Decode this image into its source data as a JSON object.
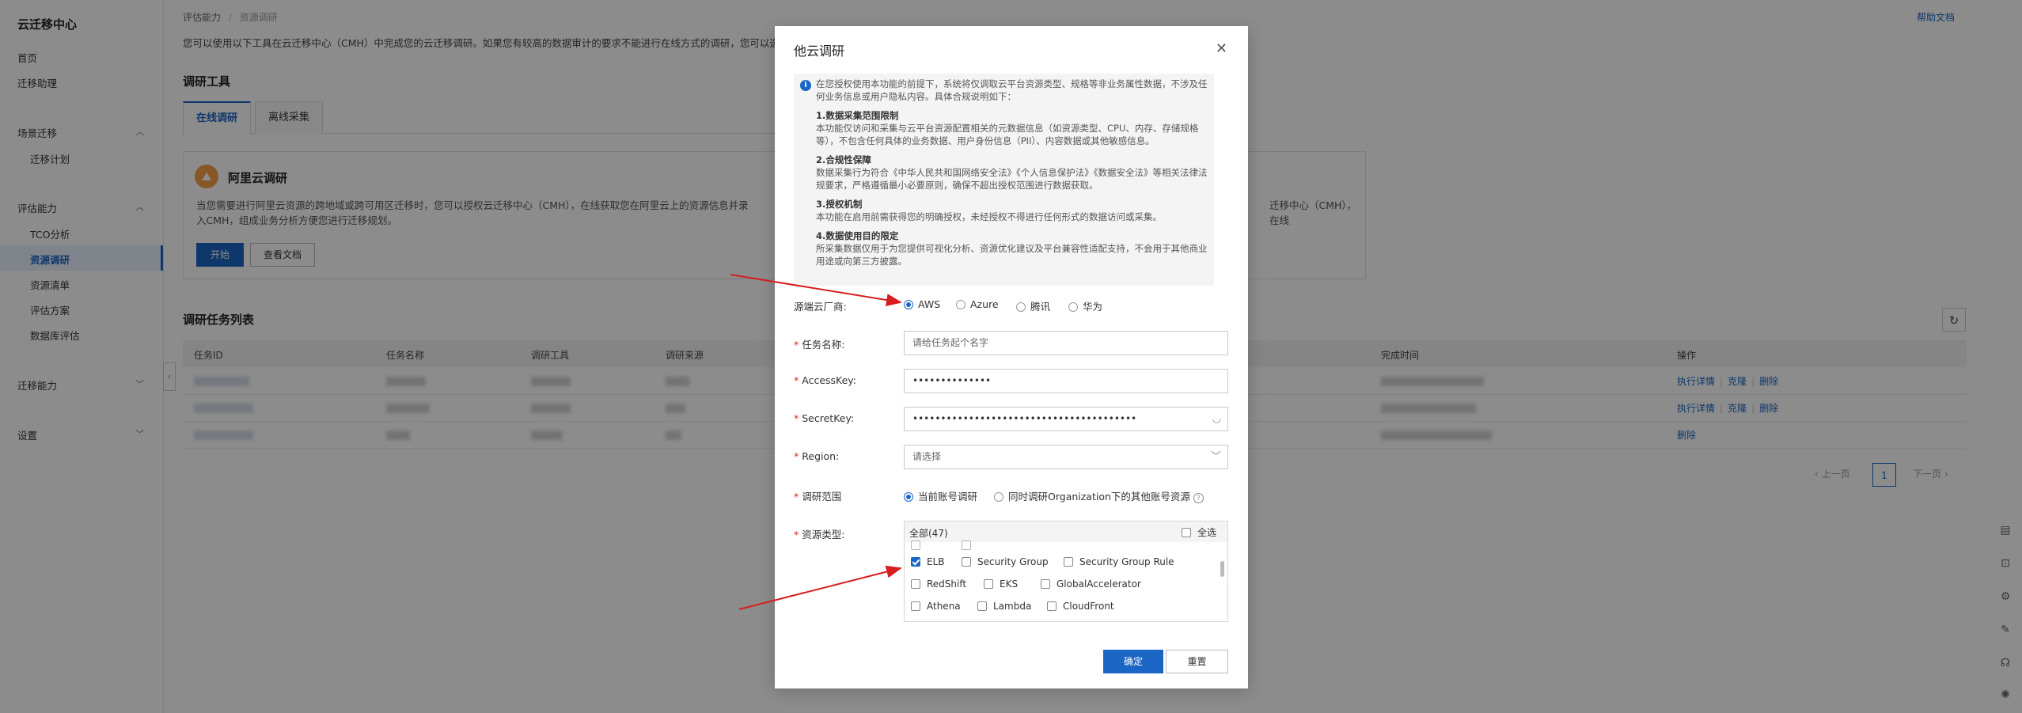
{
  "sidebar": {
    "title": "云迁移中心",
    "items": {
      "home": "首页",
      "assistant": "迁移助理",
      "scene": "场景迁移",
      "plan": "迁移计划",
      "assess": "评估能力",
      "tco": "TCO分析",
      "research": "资源调研",
      "inventory": "资源清单",
      "scheme": "评估方案",
      "db_assess": "数据库评估",
      "migrate": "迁移能力",
      "settings": "设置"
    }
  },
  "header": {
    "breadcrumb_1": "评估能力",
    "breadcrumb_sep": "/",
    "breadcrumb_2": "资源调研",
    "help": "帮助文档"
  },
  "main": {
    "description": "您可以使用以下工具在云迁移中心（CMH）中完成您的云迁移调研。如果您有较高的数据审计的要求不能进行在线方式的调研，您可以选择相",
    "tools_title": "调研工具",
    "tab_online": "在线调研",
    "tab_offline": "离线采集",
    "card_title": "阿里云调研",
    "card_text": "当您需要进行阿里云资源的跨地域或跨可用区迁移时，您可以授权云迁移中心（CMH），在线获取您在阿里云上的资源信息并录入CMH，组成业务分析方便您进行迁移规划。",
    "card_text_right": "迁移中心（CMH），在线",
    "btn_start": "开始",
    "btn_docs": "查看文档",
    "task_list_title": "调研任务列表",
    "columns": [
      "任务ID",
      "任务名称",
      "调研工具",
      "调研来源",
      "完成时间",
      "操作"
    ],
    "row_ops": [
      [
        "执行详情",
        "克隆",
        "删除"
      ],
      [
        "执行详情",
        "克隆",
        "删除"
      ],
      [
        "删除"
      ]
    ],
    "pager_prev": "上一页",
    "pager_page": "1",
    "pager_next": "下一页"
  },
  "modal": {
    "title": "他云调研",
    "notice_intro": "在您授权使用本功能的前提下，系统将仅调取云平台资源类型、规格等非业务属性数据，不涉及任何业务信息或用户隐私内容。具体合规说明如下：",
    "sections": [
      {
        "h": "1.数据采集范围限制",
        "t": "本功能仅访问和采集与云平台资源配置相关的元数据信息（如资源类型、CPU、内存、存储规格等），不包含任何具体的业务数据、用户身份信息（PII）、内容数据或其他敏感信息。"
      },
      {
        "h": "2.合规性保障",
        "t": "数据采集行为符合《中华人民共和国网络安全法》《个人信息保护法》《数据安全法》等相关法律法规要求，严格遵循最小必要原则，确保不超出授权范围进行数据获取。"
      },
      {
        "h": "3.授权机制",
        "t": "本功能在启用前需获得您的明确授权，未经授权不得进行任何形式的数据访问或采集。"
      },
      {
        "h": "4.数据使用目的限定",
        "t": "所采集数据仅用于为您提供可视化分析、资源优化建议及平台兼容性适配支持，不会用于其他商业用途或向第三方披露。"
      }
    ],
    "vendor_label": "源端云厂商:",
    "vendors": [
      "AWS",
      "Azure",
      "腾讯",
      "华为"
    ],
    "vendor_selected": "AWS",
    "task_name_label": "任务名称:",
    "task_name_placeholder": "请给任务起个名字",
    "accesskey_label": "AccessKey:",
    "accesskey_value": "••••••••••••••",
    "secretkey_label": "SecretKey:",
    "secretkey_value": "••••••••••••••••••••••••••••••••••••••••",
    "region_label": "Region:",
    "region_placeholder": "请选择",
    "scope_label": "调研范围",
    "scope_options": [
      "当前账号调研",
      "同时调研Organization下的其他账号资源"
    ],
    "scope_selected": "当前账号调研",
    "restype_label": "资源类型:",
    "restype_all": "全部(47)",
    "restype_select_all": "全选",
    "res_rows": [
      [
        {
          "name": "ELB",
          "checked": true
        },
        {
          "name": "Security Group",
          "checked": false
        },
        {
          "name": "Security Group Rule",
          "checked": false
        }
      ],
      [
        {
          "name": "RedShift",
          "checked": false
        },
        {
          "name": "EKS",
          "checked": false
        },
        {
          "name": "GlobalAccelerator",
          "checked": false
        }
      ],
      [
        {
          "name": "Athena",
          "checked": false
        },
        {
          "name": "Lambda",
          "checked": false
        },
        {
          "name": "CloudFront",
          "checked": false
        }
      ]
    ],
    "btn_ok": "确定",
    "btn_reset": "重置"
  }
}
